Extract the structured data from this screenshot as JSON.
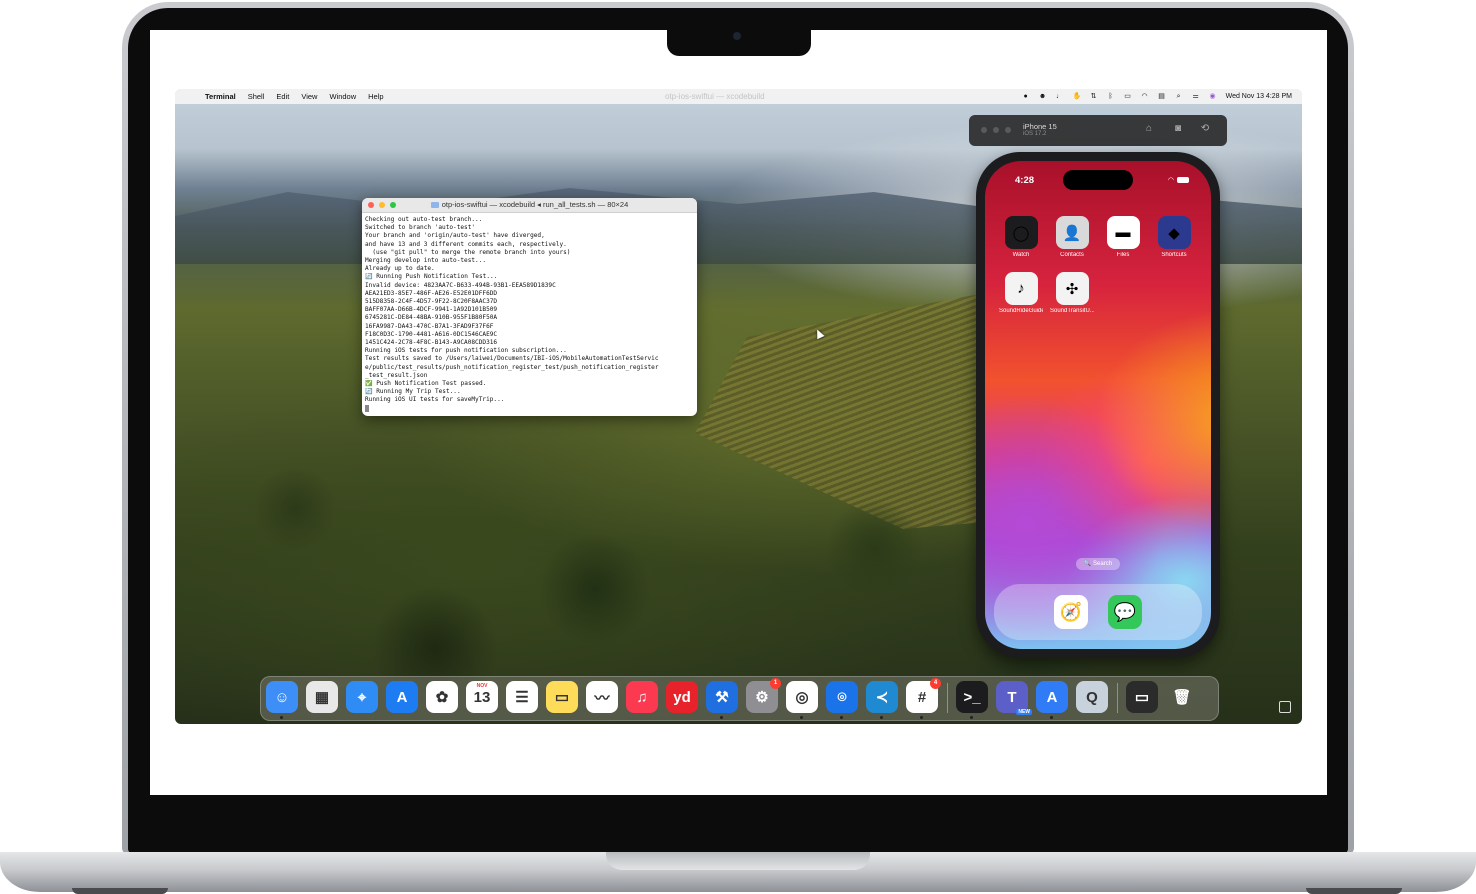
{
  "menubar": {
    "apple": "",
    "app": "Terminal",
    "items": [
      "Shell",
      "Edit",
      "View",
      "Window",
      "Help"
    ],
    "faint_title": "otp-ios-swiftui — xcodebuild",
    "datetime": "Wed Nov 13  4:28 PM"
  },
  "terminal": {
    "title": "otp-ios-swiftui — xcodebuild ◂ run_all_tests.sh — 80×24",
    "lines": [
      "Checking out auto-test branch...",
      "Switched to branch 'auto-test'",
      "Your branch and 'origin/auto-test' have diverged,",
      "and have 13 and 3 different commits each, respectively.",
      "  (use \"git pull\" to merge the remote branch into yours)",
      "Merging develop into auto-test...",
      "Already up to date.",
      "🔄 Running Push Notification Test...",
      "Invalid device: 4823AA7C-B633-494B-93B1-EEA589D1839C",
      "AEA21ED3-85E7-486F-AE26-E52E01DFF6DD",
      "515D8358-2C4F-4D57-9F22-8C20F8AAC37D",
      "BAFF07AA-D66B-4DCF-9941-1A92D101B509",
      "6745281C-DE84-48BA-910B-955F1B80F50A",
      "16FA9987-DA43-470C-B7A1-3FAD9F37F6F",
      "F18C0D3C-1790-4481-A616-0DC1546CAE9C",
      "1451C424-2C78-4F8C-B143-A9CA08CDD316",
      "Running iOS tests for push notification subscription...",
      "Test results saved to /Users/laiwei/Documents/IBI-iOS/MobileAutomationTestServic",
      "e/public/test_results/push_notification_register_test/push_notification_register",
      "_test_result.json",
      "✅ Push Notification Test passed.",
      "🔄 Running My Trip Test...",
      "Running iOS UI tests for saveMyTrip..."
    ]
  },
  "simulator": {
    "device": "iPhone 15",
    "os": "iOS 17.2",
    "time": "4:28",
    "apps": [
      {
        "label": "Watch",
        "glyph": "◯",
        "bg": "#1c1c1e"
      },
      {
        "label": "Contacts",
        "glyph": "👤",
        "bg": "#d9d9d9"
      },
      {
        "label": "Files",
        "glyph": "▬",
        "bg": "#ffffff"
      },
      {
        "label": "Shortcuts",
        "glyph": "◆",
        "bg": "#2b3a8f"
      },
      {
        "label": "SoundRideGuide",
        "glyph": "♪",
        "bg": "#f3f3f3"
      },
      {
        "label": "SoundTransitU...",
        "glyph": "✣",
        "bg": "#f3f3f3"
      }
    ],
    "search": "🔍 Search",
    "dock": [
      {
        "name": "safari",
        "glyph": "🧭",
        "bg": "#ffffff"
      },
      {
        "name": "messages",
        "glyph": "💬",
        "bg": "#34c759"
      }
    ]
  },
  "dock": {
    "apps": [
      {
        "name": "finder",
        "glyph": "☺",
        "bg": "#3d8ef7",
        "running": true
      },
      {
        "name": "launchpad",
        "glyph": "▦",
        "bg": "#e8e8e8",
        "running": false
      },
      {
        "name": "safari",
        "glyph": "⌖",
        "bg": "#2f8cf4",
        "running": false
      },
      {
        "name": "app-store",
        "glyph": "A",
        "bg": "#1d7cf2",
        "running": false
      },
      {
        "name": "photos",
        "glyph": "✿",
        "bg": "#ffffff",
        "running": false
      },
      {
        "name": "calendar",
        "glyph": "13",
        "bg": "#ffffff",
        "running": false,
        "month": "NOV"
      },
      {
        "name": "reminders",
        "glyph": "☰",
        "bg": "#ffffff",
        "running": false
      },
      {
        "name": "notes",
        "glyph": "▭",
        "bg": "#fedc5a",
        "running": false
      },
      {
        "name": "freeform",
        "glyph": "〰",
        "bg": "#ffffff",
        "running": false
      },
      {
        "name": "music",
        "glyph": "♫",
        "bg": "#fb3a52",
        "running": false
      },
      {
        "name": "youdao",
        "glyph": "yd",
        "bg": "#e8222b",
        "running": false
      },
      {
        "name": "xcode",
        "glyph": "⚒",
        "bg": "#1f6fe0",
        "running": true
      },
      {
        "name": "system-settings",
        "glyph": "⚙",
        "bg": "#8e8e93",
        "running": false,
        "badge": "1"
      },
      {
        "name": "chrome",
        "glyph": "◎",
        "bg": "#ffffff",
        "running": true
      },
      {
        "name": "maps-pin",
        "glyph": "⌾",
        "bg": "#1a73e8",
        "running": true
      },
      {
        "name": "vscode",
        "glyph": "≺",
        "bg": "#1f8ad2",
        "running": true
      },
      {
        "name": "slack",
        "glyph": "#",
        "bg": "#ffffff",
        "running": true,
        "badge": "4"
      },
      {
        "name": "terminal",
        "glyph": ">_",
        "bg": "#1c1c1e",
        "running": true
      },
      {
        "name": "teams",
        "glyph": "T",
        "bg": "#5b5fc7",
        "running": false,
        "tag": "NEW"
      },
      {
        "name": "simulator",
        "glyph": "A",
        "bg": "#2f7cf6",
        "running": true
      },
      {
        "name": "quicktime",
        "glyph": "Q",
        "bg": "#c8d2dc",
        "running": false
      },
      {
        "name": "minimized-window",
        "glyph": "▭",
        "bg": "#2b2b2b",
        "running": false
      },
      {
        "name": "trash",
        "glyph": "🗑",
        "bg": "transparent",
        "running": false
      }
    ]
  }
}
